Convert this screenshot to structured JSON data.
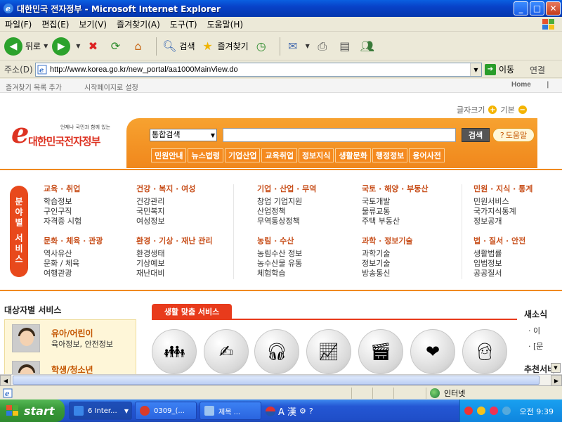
{
  "window": {
    "title": "대한민국 전자정부 - Microsoft Internet Explorer"
  },
  "menu": [
    "파일(F)",
    "편집(E)",
    "보기(V)",
    "즐겨찾기(A)",
    "도구(T)",
    "도움말(H)"
  ],
  "toolbar": {
    "back": "뒤로",
    "search": "검색",
    "favorites": "즐겨찾기"
  },
  "address": {
    "label": "주소(D)",
    "url": "http://www.korea.go.kr/new_portal/aa1000MainView.do",
    "go": "이동",
    "links": "연결"
  },
  "page": {
    "topstrip": {
      "add_fav": "즐겨찾기 목록 추가",
      "set_home": "시작페이지로 설정",
      "home": "Home"
    },
    "fontsize": {
      "label": "글자크기",
      "reset": "기본"
    },
    "logo": {
      "name": "대한민국전자정부",
      "tagline": "언제나 국민과 함께 있는"
    },
    "search": {
      "select_value": "통합검색",
      "button": "검색",
      "help": "도움말"
    },
    "tabs": [
      "민원안내",
      "뉴스법령",
      "기업산업",
      "교육취업",
      "정보지식",
      "생활문화",
      "행정정보",
      "용어사전"
    ],
    "category_label": "분야별 서비스",
    "categories_row1": [
      {
        "title": "교육 · 취업",
        "items": [
          "학습정보",
          "구인구직",
          "자격증 시험"
        ]
      },
      {
        "title": "건강 · 복지 · 여성",
        "items": [
          "건강관리",
          "국민복지",
          "여성정보"
        ]
      },
      {
        "title": "기업 · 산업 · 무역",
        "items": [
          "창업 기업지원",
          "산업정책",
          "무역통상정책"
        ]
      },
      {
        "title": "국토 · 해양 · 부동산",
        "items": [
          "국토개발",
          "물류교통",
          "주택 부동산"
        ]
      },
      {
        "title": "민원 · 지식 · 통계",
        "items": [
          "민원서비스",
          "국가지식통계",
          "정보공개"
        ]
      }
    ],
    "categories_row2": [
      {
        "title": "문화 · 체육 · 관광",
        "items": [
          "역사유산",
          "문화 / 체육",
          "여행관광"
        ]
      },
      {
        "title": "환경 · 기상 · 재난 관리",
        "items": [
          "환경생태",
          "기상예보",
          "재난대비"
        ]
      },
      {
        "title": "농림 · 수산",
        "items": [
          "농림수산 정보",
          "농수산물 유통",
          "체험학습"
        ]
      },
      {
        "title": "과학 · 정보기술",
        "items": [
          "과학기술",
          "정보기술",
          "방송통신"
        ]
      },
      {
        "title": "법 · 질서 · 안전",
        "items": [
          "생활법률",
          "입법정보",
          "공공질서"
        ]
      }
    ],
    "target": {
      "title": "대상자별 서비스",
      "item1_title": "유아/어린이",
      "item1_desc": "육아정보, 안전정보",
      "item2_title": "학생/청소년"
    },
    "life": {
      "title": "생활 맞춤 서비스"
    },
    "news": {
      "title": "새소식",
      "item1": "· 이",
      "item2": "· [문"
    },
    "recommend": {
      "title": "추천서비"
    }
  },
  "status": {
    "zone": "인터넷"
  },
  "taskbar": {
    "start": "start",
    "tasks": [
      "6 Inter...",
      "0309_(...",
      "제목 ..."
    ],
    "clock": "오전 9:39",
    "lang": "A 漢"
  }
}
